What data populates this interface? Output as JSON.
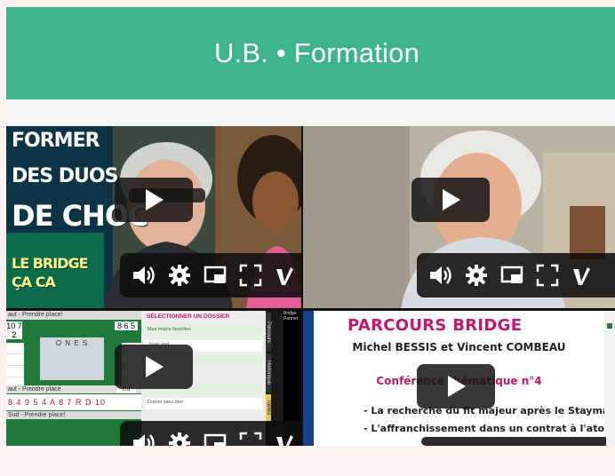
{
  "header": {
    "title": "U.B. • Formation"
  },
  "tiles": {
    "t1": {
      "promo_lines": [
        "FORMER",
        "DES DUOS",
        "DE CHOC",
        "LE BRIDGE",
        "ÇA CA"
      ]
    },
    "t3": {
      "top_label": "aut - Prendre place!",
      "seats": "O N E S",
      "score_a": "8 6 5",
      "score_b": "10 7 2",
      "panel_title": "SÉLECTIONNER UN DOSSIER",
      "row1": "Mes mains favorites",
      "row2": "Jouer test",
      "row3": "Donne sans titre",
      "bottom_label_1": "aut - Prendre place",
      "bottom_label_2": "Sud - Prendre place!",
      "cards_row": "8 4 9 5 4 A 8 7 R D 10",
      "side_tab_1": "Historique",
      "side_tab_2": "Parcours",
      "side_tab_3": "Tables",
      "btn": "Éd",
      "hdr_right": "Bridge Partner"
    },
    "t4": {
      "title": "PARCOURS BRIDGE",
      "authors": "Michel BESSIS et Vincent COMBEAU",
      "conf": "Conférence thématique n°4",
      "bullet1": "- La recherche du fit majeur après le Stayman",
      "bullet2": "- L'affranchissement dans un contrat à l'atout"
    }
  },
  "icons": [
    "play-icon",
    "volume-icon",
    "settings-icon",
    "pip-icon",
    "fullscreen-icon",
    "vimeo-logo"
  ],
  "colors": {
    "header_bg": "#3fb389",
    "accent_magenta": "#c0186d",
    "felt_green": "#1f7a3a"
  }
}
